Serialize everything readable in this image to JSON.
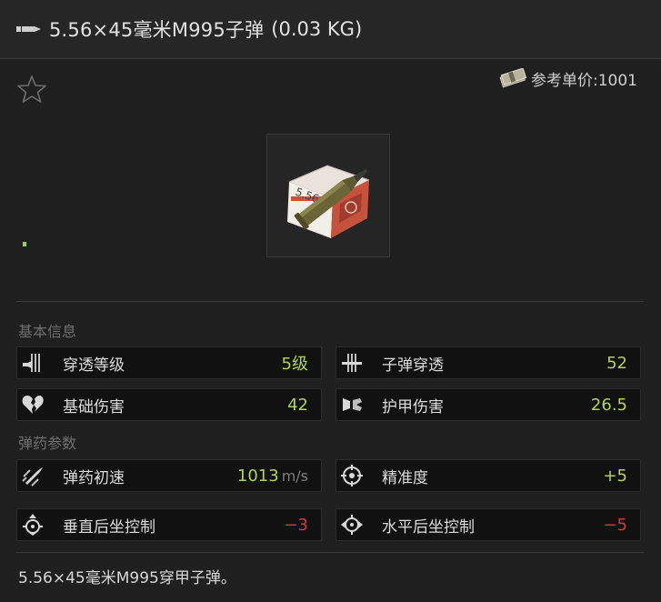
{
  "header": {
    "icon": "bullet-icon",
    "item_name": "5.56×45毫米M995子弹",
    "weight": "(0.03 KG)"
  },
  "price": {
    "icon": "money-icon",
    "label": "参考单价:1001"
  },
  "favorite": {
    "icon": "star-outline-icon"
  },
  "item_image": {
    "icon": "ammo-box-with-cartridge-icon",
    "box_text": "5.56"
  },
  "sections": {
    "basic_info": "基本信息",
    "ammo_params": "弹药参数"
  },
  "stats": {
    "penetration_level": {
      "icon": "penetration-level-icon",
      "label": "穿透等级",
      "value": "5级",
      "color": "#b2d161"
    },
    "bullet_penetration": {
      "icon": "bullet-penetration-icon",
      "label": "子弹穿透",
      "value": "52",
      "color": "#b2d161"
    },
    "base_damage": {
      "icon": "broken-heart-icon",
      "label": "基础伤害",
      "value": "42",
      "color": "#b2d161"
    },
    "armor_damage": {
      "icon": "armor-damage-icon",
      "label": "护甲伤害",
      "value": "26.5",
      "color": "#b2d161"
    },
    "muzzle_velocity": {
      "icon": "muzzle-velocity-icon",
      "label": "弹药初速",
      "value": "1013",
      "unit": "m/s",
      "color": "#b2d161"
    },
    "accuracy": {
      "icon": "crosshair-icon",
      "label": "精准度",
      "value": "+5",
      "color": "#b2d161"
    },
    "vertical_recoil": {
      "icon": "vertical-recoil-icon",
      "label": "垂直后坐控制",
      "value": "−3",
      "color": "#cf3b37"
    },
    "horizontal_recoil": {
      "icon": "horizontal-recoil-icon",
      "label": "水平后坐控制",
      "value": "−5",
      "color": "#cf3b37"
    }
  },
  "description": "5.56×45毫米M995穿甲子弹。"
}
